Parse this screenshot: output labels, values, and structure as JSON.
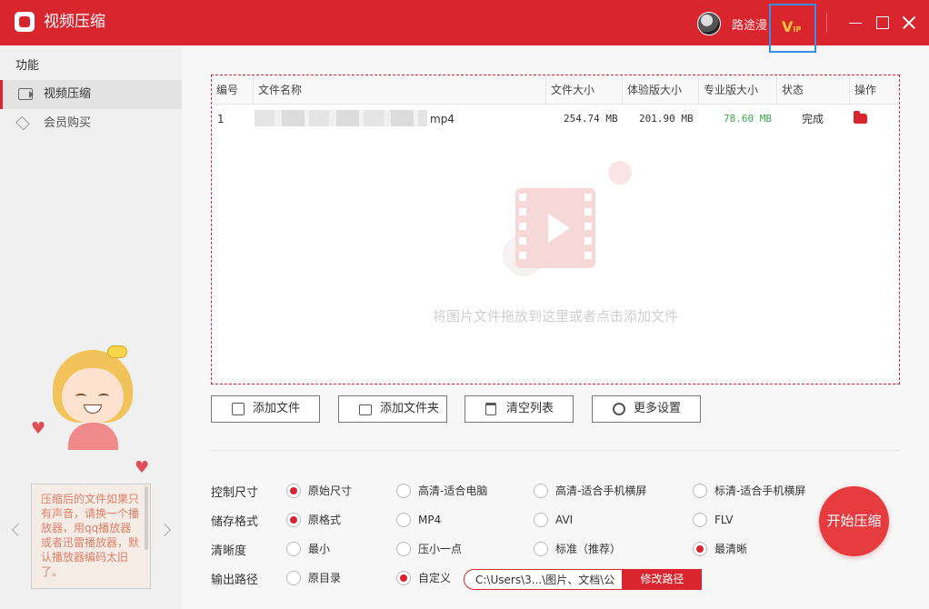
{
  "app": {
    "title": "视频压缩",
    "username": "路途漫",
    "vip_label": "V",
    "vip_sub": "IP"
  },
  "sidebar": {
    "heading": "功能",
    "items": [
      {
        "label": "视频压缩",
        "active": true,
        "icon": "video-icon"
      },
      {
        "label": "会员购买",
        "active": false,
        "icon": "diamond-icon"
      }
    ]
  },
  "tip": {
    "text": "压缩后的文件如果只有声音，请换一个播放器，用qq播放器或者迅雷播放器，默认播放器编码太旧了。"
  },
  "table": {
    "headers": [
      "编号",
      "文件名称",
      "文件大小",
      "体验版大小",
      "专业版大小",
      "状态",
      "操作"
    ],
    "rows": [
      {
        "index": "1",
        "name_suffix": "mp4",
        "size": "254.74 MB",
        "trial_size": "201.90 MB",
        "pro_size": "78.60 MB",
        "status": "完成"
      }
    ],
    "empty_hint": "将图片文件拖放到这里或者点击添加文件"
  },
  "toolbar": {
    "add_file": "添加文件",
    "add_folder": "添加文件夹",
    "clear_list": "清空列表",
    "more_settings": "更多设置"
  },
  "options": {
    "size": {
      "label": "控制尺寸",
      "choices": [
        "原始尺寸",
        "高清-适合电脑",
        "高清-适合手机横屏",
        "标清-适合手机横屏"
      ],
      "selected": 0
    },
    "format": {
      "label": "储存格式",
      "choices": [
        "原格式",
        "MP4",
        "AVI",
        "FLV"
      ],
      "selected": 0
    },
    "clarity": {
      "label": "清晰度",
      "choices": [
        "最小",
        "压小一点",
        "标准（推荐）",
        "最清晰"
      ],
      "selected": 3
    },
    "output": {
      "label": "输出路径",
      "choices": [
        "原目录",
        "自定义"
      ],
      "selected": 1,
      "path": "C:\\Users\\3...\\图片、文档\\公",
      "change_label": "修改路径"
    }
  },
  "start_label": "开始压缩",
  "colors": {
    "accent": "#d9262e",
    "pro_size": "#3daa4a",
    "vip_highlight": "#3a8ee6"
  }
}
